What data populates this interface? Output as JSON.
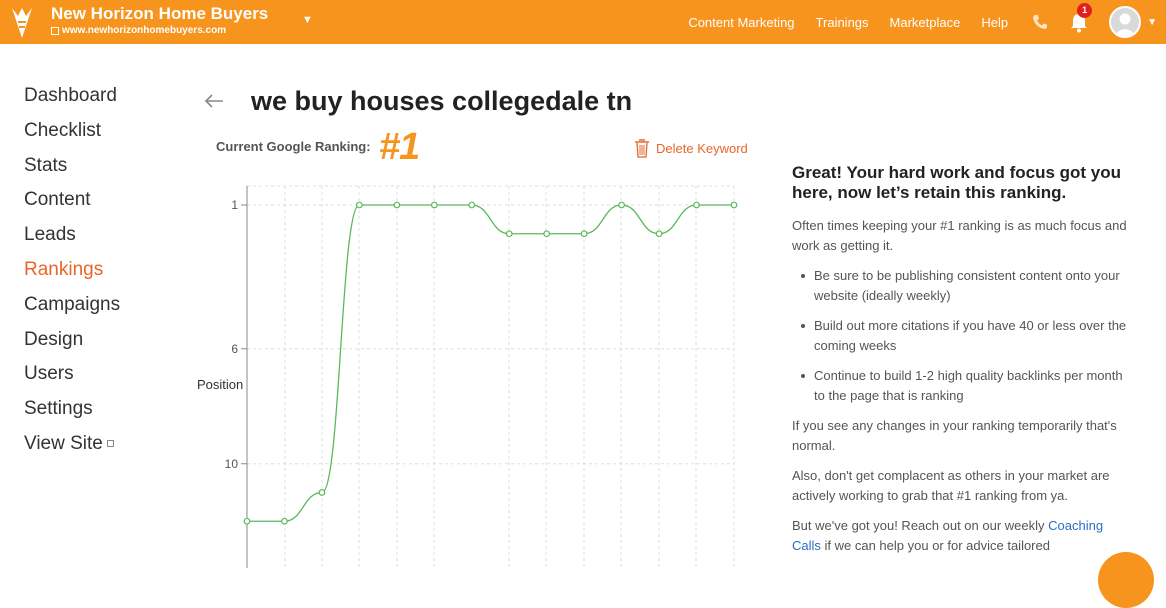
{
  "topbar": {
    "brand_name": "New Horizon Home Buyers",
    "brand_url": "www.newhorizonhomebuyers.com",
    "nav": [
      "Content Marketing",
      "Trainings",
      "Marketplace",
      "Help"
    ],
    "notification_count": "1",
    "accent_color": "#f7941d"
  },
  "sidebar": {
    "items": [
      {
        "label": "Dashboard"
      },
      {
        "label": "Checklist"
      },
      {
        "label": "Stats"
      },
      {
        "label": "Content"
      },
      {
        "label": "Leads"
      },
      {
        "label": "Rankings",
        "active": true
      },
      {
        "label": "Campaigns"
      },
      {
        "label": "Design"
      },
      {
        "label": "Users"
      },
      {
        "label": "Settings"
      },
      {
        "label": "View Site"
      }
    ]
  },
  "main": {
    "title": "we buy houses collegedale tn",
    "ranking_label": "Current Google Ranking:",
    "ranking_value": "#1",
    "delete_label": "Delete Keyword"
  },
  "chart_data": {
    "type": "line",
    "ylabel": "Position",
    "y_ticks": [
      "1",
      "6",
      "10"
    ],
    "y_reversed": true,
    "series": [
      {
        "values": [
          12,
          12,
          11,
          1,
          1,
          1,
          1,
          2,
          2,
          2,
          1,
          2,
          1,
          1
        ]
      }
    ],
    "line_color": "#5cb85c",
    "grid": true
  },
  "advice": {
    "heading": "Great! Your hard work and focus got you here, now let’s retain this ranking.",
    "intro": "Often times keeping your #1 ranking is as much focus and work as getting it.",
    "bullets": [
      "Be sure to be publishing consistent content onto your website (ideally weekly)",
      "Build out more citations if you have 40 or less over the coming weeks",
      "Continue to build 1-2 high quality backlinks per month to the page that is ranking"
    ],
    "p2": "If you see any changes in your ranking temporarily that's normal.",
    "p3": "Also, don't get complacent as others in your market are actively working to grab that #1 ranking from ya.",
    "p4_pre": "But we've got you! Reach out on our weekly ",
    "p4_link": "Coaching Calls",
    "p4_post": " if we can help you or for advice tailored"
  }
}
